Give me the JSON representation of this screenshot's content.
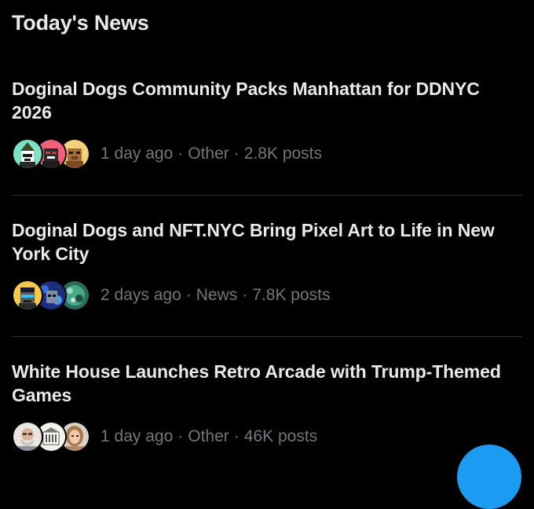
{
  "section": {
    "title": "Today's News"
  },
  "news": [
    {
      "headline": "Doginal Dogs Community Packs Manhattan for DDNYC 2026",
      "time": "1 day ago",
      "category": "Other",
      "posts": "2.8K posts"
    },
    {
      "headline": "Doginal Dogs and NFT.NYC Bring Pixel Art to Life in New York City",
      "time": "2 days ago",
      "category": "News",
      "posts": "7.8K posts"
    },
    {
      "headline": "White House Launches Retro Arcade with Trump-Themed Games",
      "time": "1 day ago",
      "category": "Other",
      "posts": "46K posts"
    }
  ],
  "meta_separator": "·",
  "colors": {
    "background": "#000000",
    "primary_text": "#e7e9ea",
    "secondary_text": "#71767b",
    "divider": "#2f3336",
    "accent": "#1d9bf0"
  },
  "icons": {
    "compose_button": "compose-fab-icon"
  }
}
